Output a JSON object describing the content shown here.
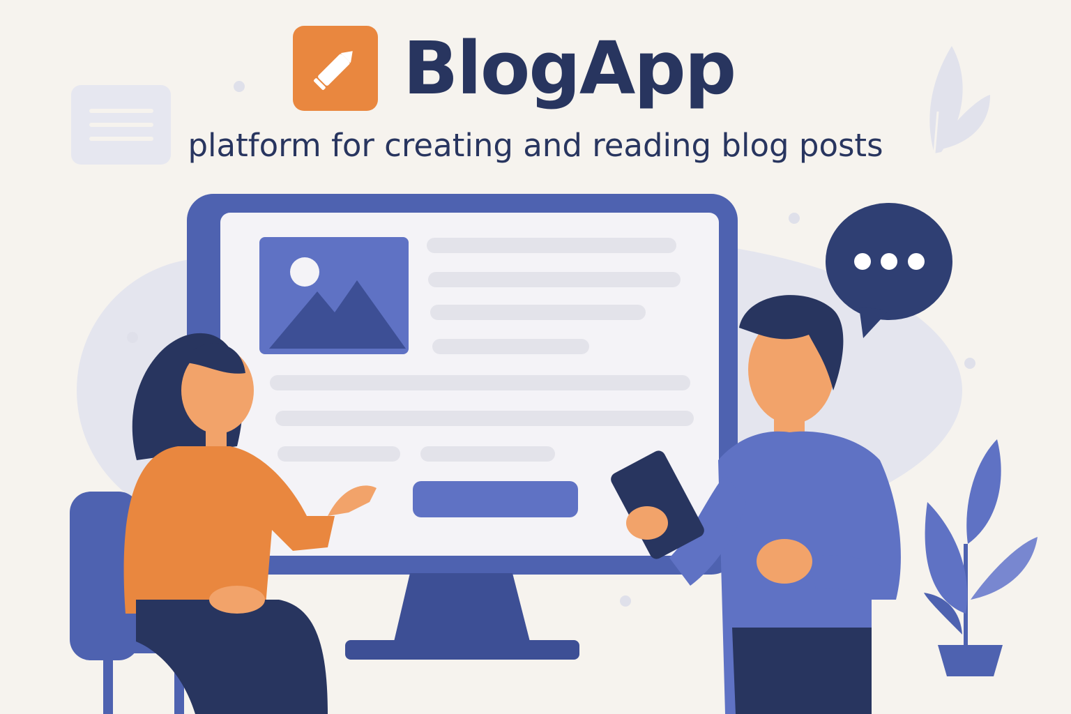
{
  "brand": {
    "app_name": "BlogApp",
    "tagline": "platform for creating and reading blog posts",
    "logo_icon": "pencil-icon"
  },
  "colors": {
    "background": "#f6f3ee",
    "brand_orange": "#e9873f",
    "navy": "#28355f",
    "blue": "#5f72c4",
    "light_gray": "#e3e3ea"
  },
  "illustration": {
    "monitor_icon": "monitor-icon",
    "image_placeholder_icon": "image-icon",
    "speech_bubble_icon": "speech-bubble-icon",
    "plant_icon": "plant-icon"
  }
}
